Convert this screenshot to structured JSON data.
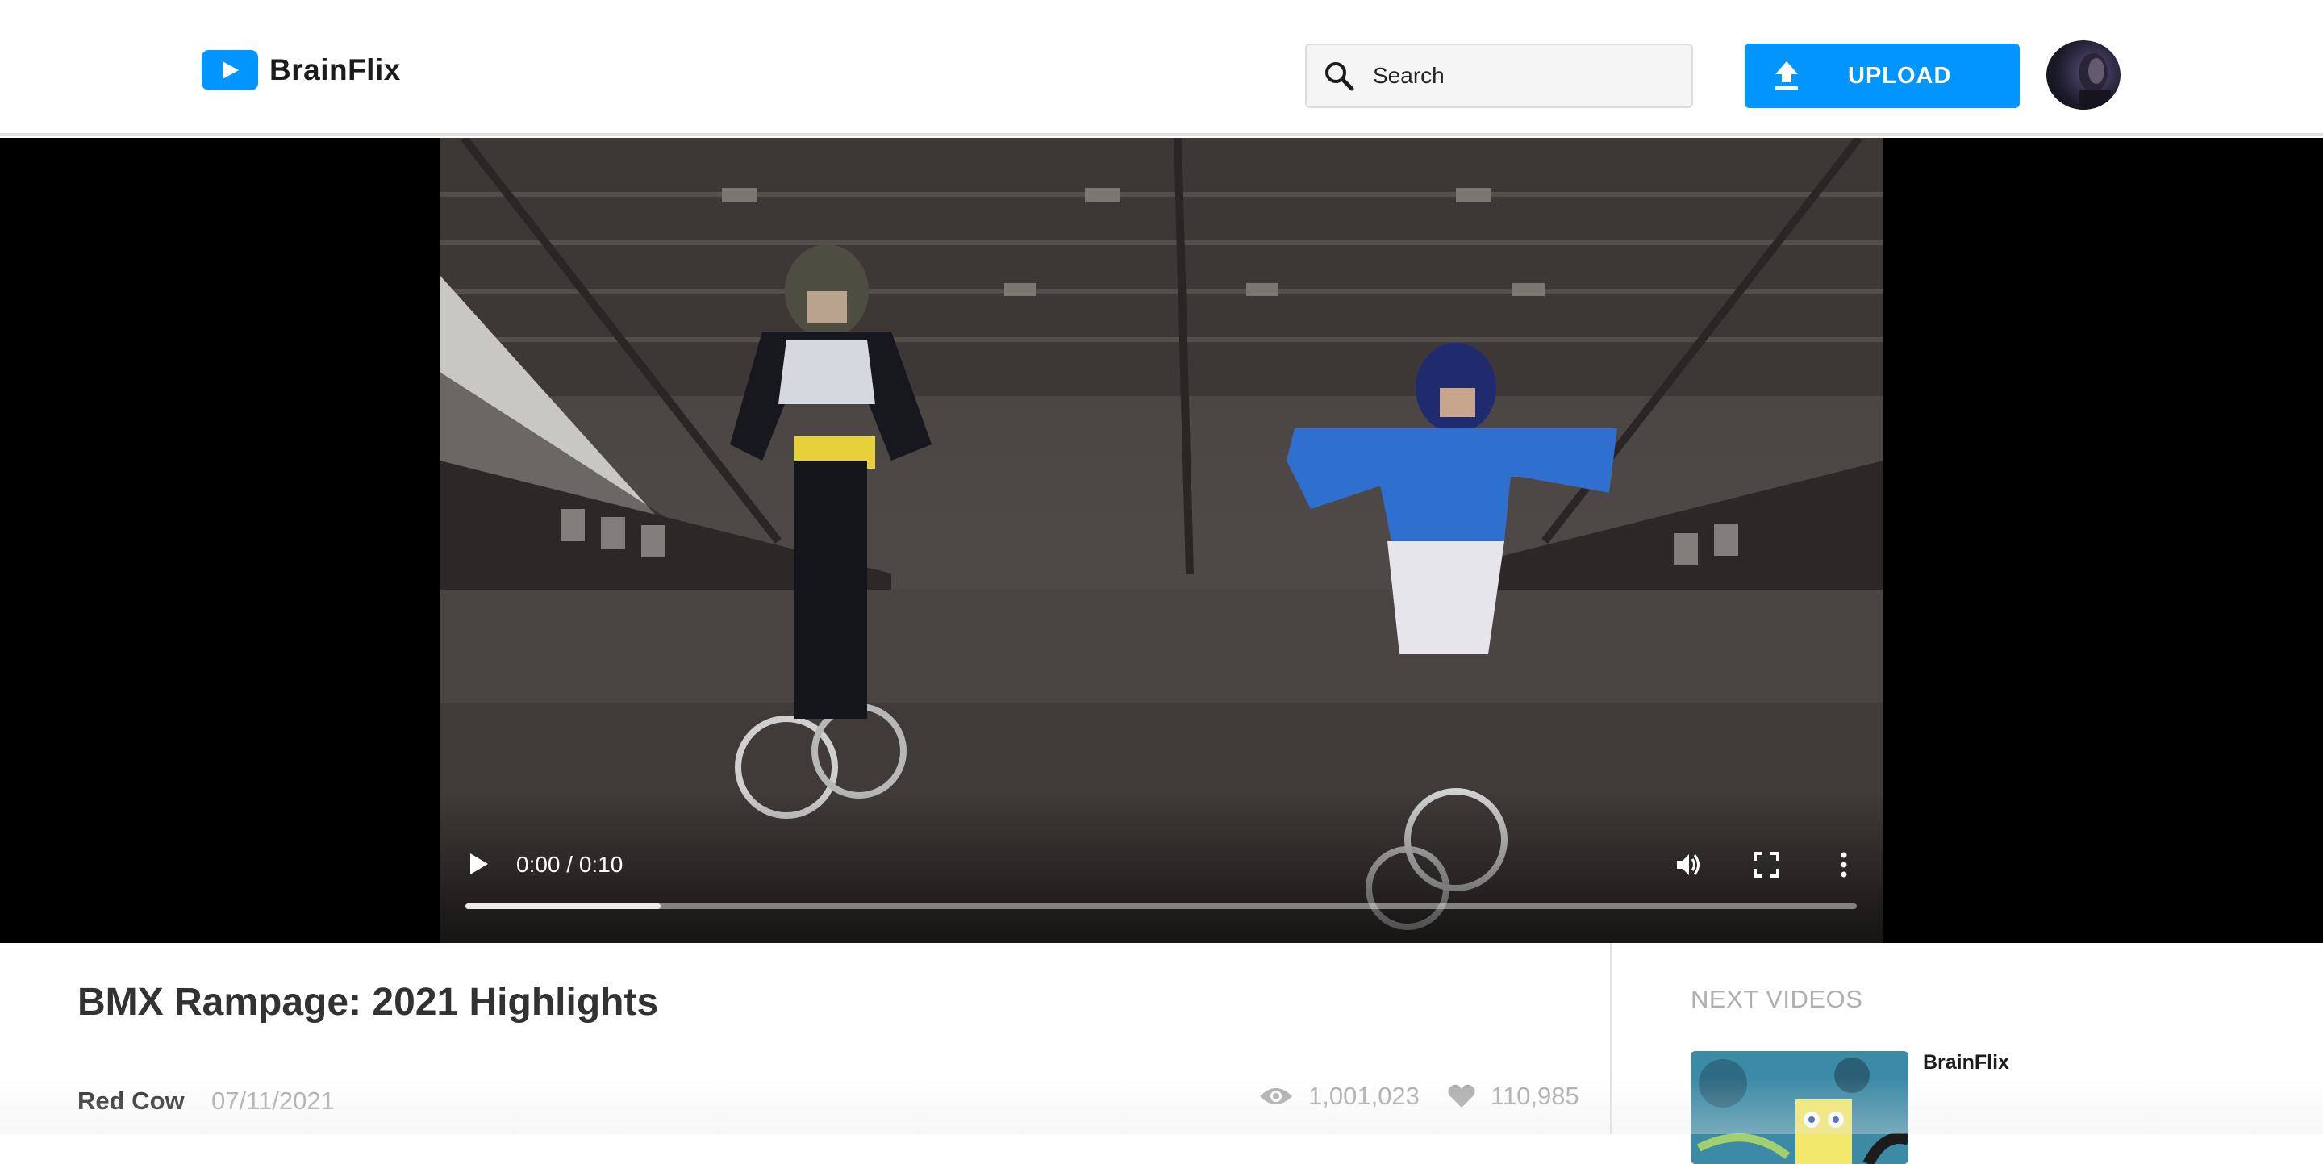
{
  "app": {
    "name": "BrainFlix"
  },
  "header": {
    "logo_text": "BrainFlix",
    "search": {
      "placeholder": "Search",
      "icon": "search-icon"
    },
    "upload": {
      "label": "UPLOAD",
      "icon": "upload-icon"
    },
    "avatar": "user-avatar"
  },
  "video": {
    "controls": {
      "time": "0:00 / 0:10",
      "buffered_fraction": 0.14,
      "icons": [
        "play-icon",
        "volume-icon",
        "fullscreen-icon",
        "more-vertical-icon"
      ]
    }
  },
  "details": {
    "title": "BMX Rampage: 2021 Highlights",
    "author": "Red Cow",
    "date": "07/11/2021",
    "views": "1,001,023",
    "likes": "110,985",
    "icons": [
      "eye-icon",
      "heart-icon"
    ]
  },
  "sidebar": {
    "heading": "NEXT VIDEOS",
    "items": [
      {
        "channel": "BrainFlix"
      }
    ]
  },
  "colors": {
    "brand": "#0095ff",
    "text_dark": "#323232",
    "text_muted": "#afafaf",
    "divider": "#e1e1e1"
  }
}
